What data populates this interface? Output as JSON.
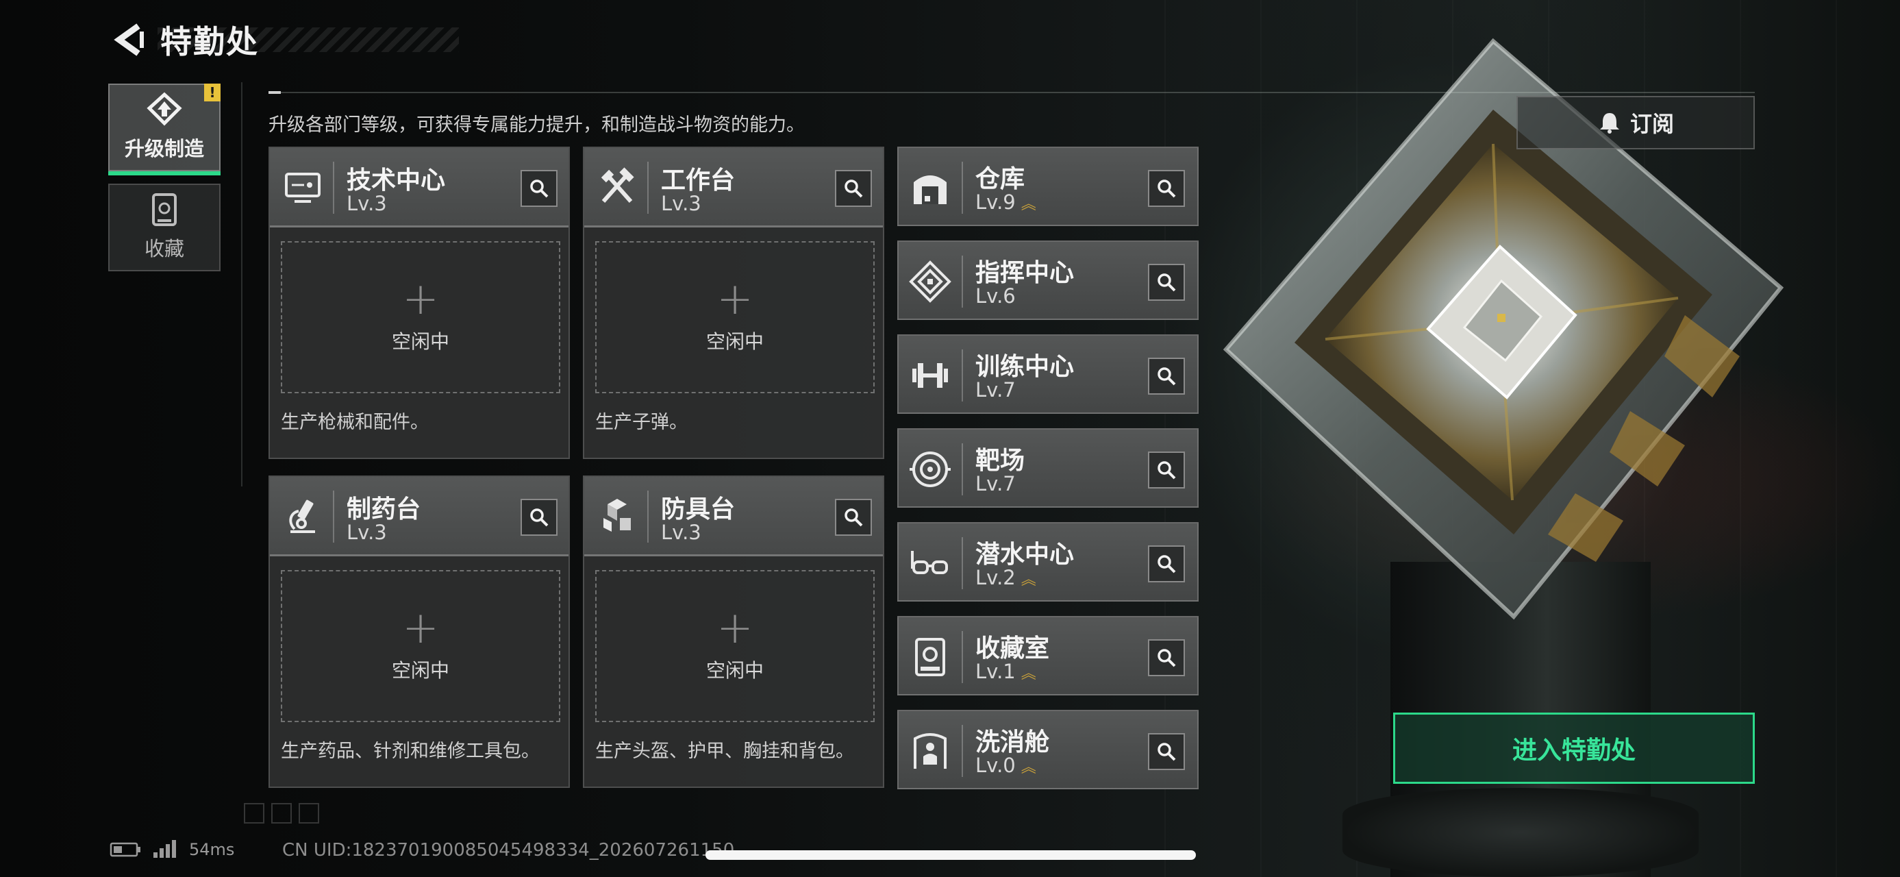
{
  "header": {
    "title": "特勤处",
    "back_icon": "back-arrow-icon"
  },
  "subtitle": "升级各部门等级，可获得专属能力提升，和制造战斗物资的能力。",
  "sidebar": {
    "items": [
      {
        "label": "升级制造",
        "icon": "upgrade-icon",
        "active": true,
        "alert": "!"
      },
      {
        "label": "收藏",
        "icon": "collection-icon",
        "active": false
      }
    ]
  },
  "subscribe": {
    "label": "订阅",
    "icon": "bell-icon"
  },
  "production_cards": [
    {
      "name": "技术中心",
      "level": "Lv.3",
      "icon": "tech-center-icon",
      "slot_status": "空闲中",
      "description": "生产枪械和配件。"
    },
    {
      "name": "工作台",
      "level": "Lv.3",
      "icon": "workbench-icon",
      "slot_status": "空闲中",
      "description": "生产子弹。"
    },
    {
      "name": "制药台",
      "level": "Lv.3",
      "icon": "pharmacy-icon",
      "slot_status": "空闲中",
      "description": "生产药品、针剂和维修工具包。"
    },
    {
      "name": "防具台",
      "level": "Lv.3",
      "icon": "armor-bench-icon",
      "slot_status": "空闲中",
      "description": "生产头盔、护甲、胸挂和背包。"
    }
  ],
  "facility_list": [
    {
      "name": "仓库",
      "level": "Lv.9",
      "icon": "warehouse-icon",
      "upgradable": true
    },
    {
      "name": "指挥中心",
      "level": "Lv.6",
      "icon": "command-center-icon",
      "upgradable": false
    },
    {
      "name": "训练中心",
      "level": "Lv.7",
      "icon": "training-center-icon",
      "upgradable": false
    },
    {
      "name": "靶场",
      "level": "Lv.7",
      "icon": "shooting-range-icon",
      "upgradable": false
    },
    {
      "name": "潜水中心",
      "level": "Lv.2",
      "icon": "diving-center-icon",
      "upgradable": true
    },
    {
      "name": "收藏室",
      "level": "Lv.1",
      "icon": "collection-room-icon",
      "upgradable": true
    },
    {
      "name": "洗消舱",
      "level": "Lv.0",
      "icon": "decontamination-icon",
      "upgradable": true
    }
  ],
  "enter_button": {
    "label": "进入特勤处"
  },
  "status": {
    "ping": "54ms",
    "uid": "CN UID:18237019008504549833­4_202607261150"
  },
  "colors": {
    "accent": "#2cd98a",
    "upgrade": "#c9a13a",
    "alert": "#e8c23a"
  }
}
